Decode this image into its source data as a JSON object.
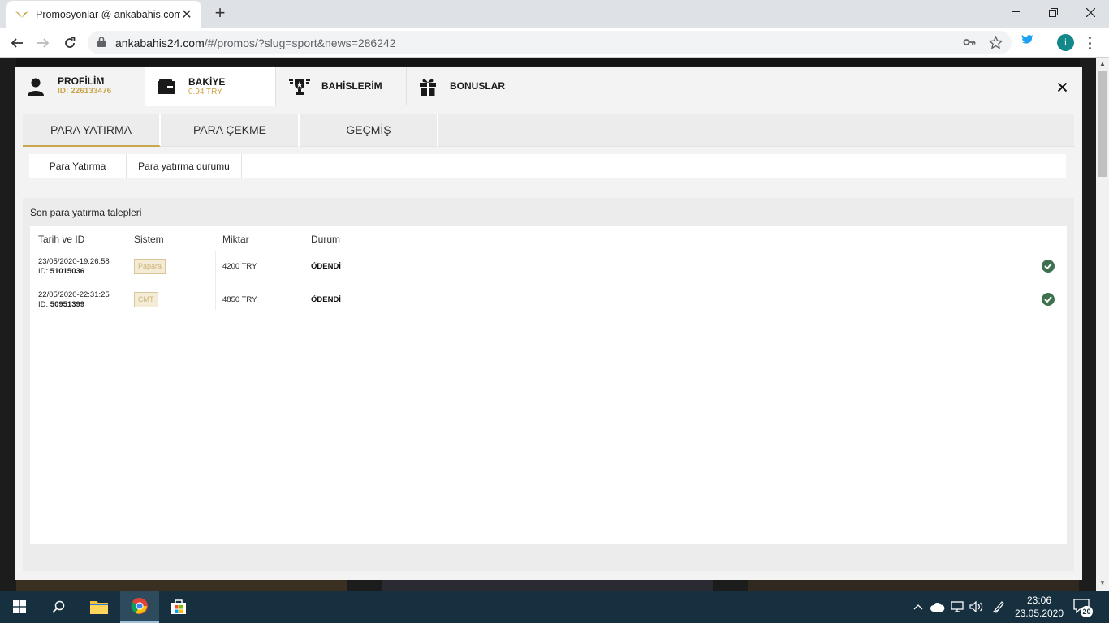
{
  "browser": {
    "tab_title": "Promosyonlar @ ankabahis.com",
    "url_host": "ankabahis24.com",
    "url_path": "/#/promos/?slug=sport&news=286242",
    "profile_initial": "i"
  },
  "modal": {
    "tabs": [
      {
        "label": "PROFİLİM",
        "sub": "ID: 226133476"
      },
      {
        "label": "BAKİYE",
        "sub": "0.94 TRY"
      },
      {
        "label": "BAHİSLERİM",
        "sub": ""
      },
      {
        "label": "BONUSLAR",
        "sub": ""
      }
    ],
    "subtabs": [
      "PARA YATIRMA",
      "PARA ÇEKME",
      "GEÇMİŞ"
    ],
    "pills": [
      "Para Yatırma",
      "Para yatırma durumu"
    ],
    "section_title": "Son para yatırma talepleri",
    "table": {
      "headers": [
        "Tarih ve ID",
        "Sistem",
        "Miktar",
        "Durum"
      ],
      "id_prefix": "ID:",
      "rows": [
        {
          "date": "23/05/2020-19:26:58",
          "id": "51015036",
          "system": "Papara",
          "amount": "4200 TRY",
          "status": "ÖDENDİ"
        },
        {
          "date": "22/05/2020-22:31:25",
          "id": "50951399",
          "system": "CMT",
          "amount": "4850 TRY",
          "status": "ÖDENDİ"
        }
      ]
    }
  },
  "taskbar": {
    "time": "23:06",
    "date": "23.05.2020",
    "notifications": "20"
  },
  "colors": {
    "accent_gold": "#c9a64c",
    "success_green": "#3f7150",
    "taskbar": "#163040"
  }
}
